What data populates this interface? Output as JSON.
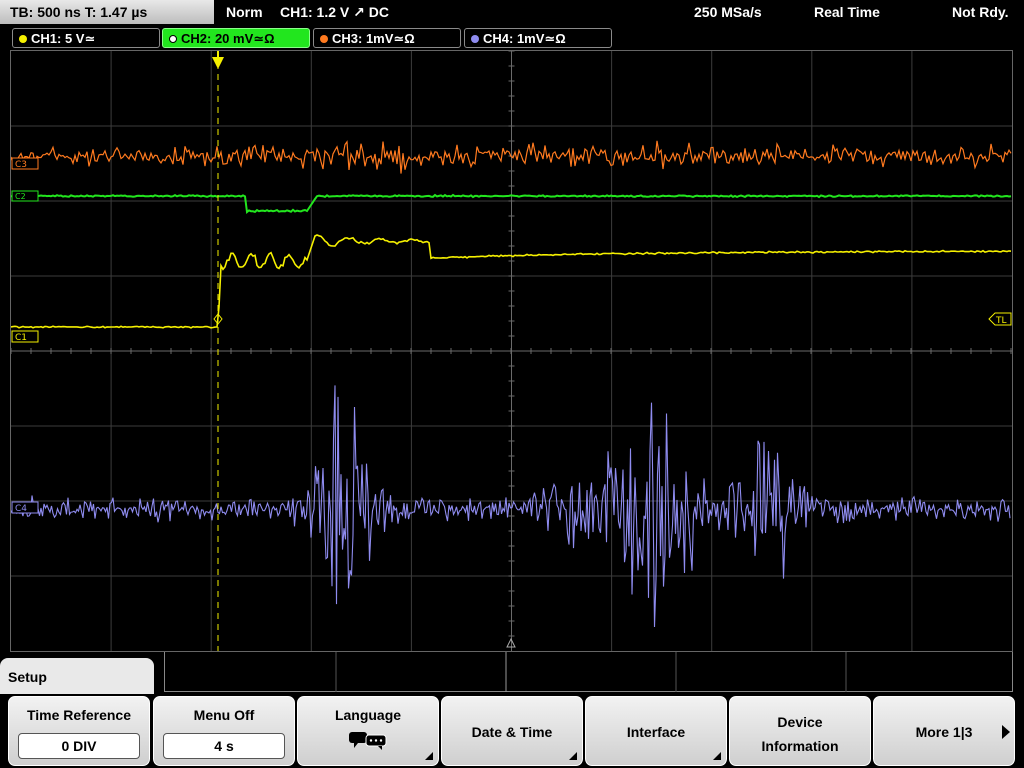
{
  "topbar": {
    "timebase": "TB: 500 ns   T: 1.47 µs",
    "mode": "Norm",
    "trigger": "CH1: 1.2 V ↗ DC",
    "sample_rate": "250 MSa/s",
    "acq_mode": "Real Time",
    "status": "Not Rdy."
  },
  "channels": [
    {
      "label": "CH1: 5 V≃",
      "color": "#f5f000"
    },
    {
      "label": "CH2: 20 mV≃Ω",
      "color": "#22e61e"
    },
    {
      "label": "CH3: 1mV≃Ω",
      "color": "#ff7a1f"
    },
    {
      "label": "CH4: 1mV≃Ω",
      "color": "#8f8cf0"
    }
  ],
  "markers": {
    "ch3": "C3",
    "ch2": "C2",
    "ch1": "C1",
    "ch4": "C4",
    "trigger_level": "TL"
  },
  "setup": {
    "title": "Setup"
  },
  "softkeys": {
    "time_reference": {
      "label": "Time Reference",
      "value": "0 DIV"
    },
    "menu_off": {
      "label": "Menu Off",
      "value": "4 s"
    },
    "language": {
      "label": "Language",
      "icon": "speech-bubble-icon"
    },
    "date_time": {
      "label": "Date & Time"
    },
    "interface": {
      "label": "Interface"
    },
    "device_info": {
      "label": "Device Information",
      "line1": "Device",
      "line2": "Information"
    },
    "more": {
      "label": "More 1|3"
    }
  },
  "colors": {
    "ch1": "#f5f000",
    "ch2": "#22e61e",
    "ch3": "#ff7a1f",
    "ch4": "#8f8cf0",
    "grid": "#555555"
  }
}
